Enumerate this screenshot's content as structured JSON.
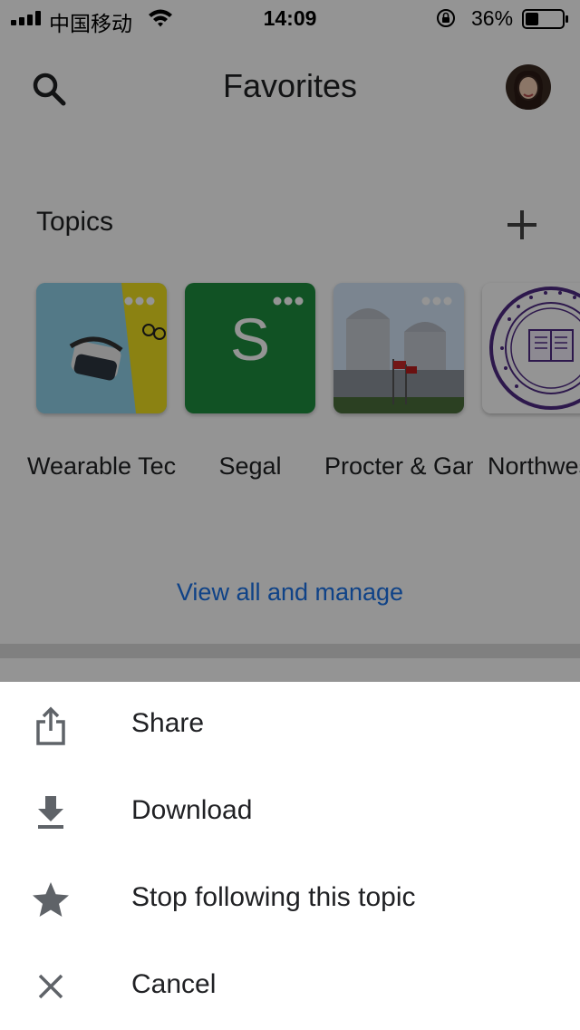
{
  "status_bar": {
    "carrier": "中国移动",
    "time": "14:09",
    "battery_percent": "36%",
    "battery_level": 0.36
  },
  "header": {
    "title": "Favorites",
    "search_icon": "search-icon",
    "avatar": "user-avatar"
  },
  "topics": {
    "title": "Topics",
    "add_icon": "plus-icon",
    "items": [
      {
        "label": "Wearable Technolo…",
        "image": "vr-headset-photo"
      },
      {
        "label": "Segal",
        "letter": "S",
        "color": "#1e8e3e"
      },
      {
        "label": "Procter & Gamble",
        "image": "office-towers-photo"
      },
      {
        "label": "Northwestern Univ",
        "image": "university-seal"
      }
    ],
    "view_all": "View all and manage"
  },
  "sheet": {
    "items": [
      {
        "label": "Share",
        "icon": "share-icon"
      },
      {
        "label": "Download",
        "icon": "download-icon"
      },
      {
        "label": "Stop following this topic",
        "icon": "star-icon"
      },
      {
        "label": "Cancel",
        "icon": "close-icon"
      }
    ]
  },
  "colors": {
    "accent": "#1a73e8",
    "text": "#202124",
    "scrim": "rgba(0,0,0,0.42)"
  }
}
